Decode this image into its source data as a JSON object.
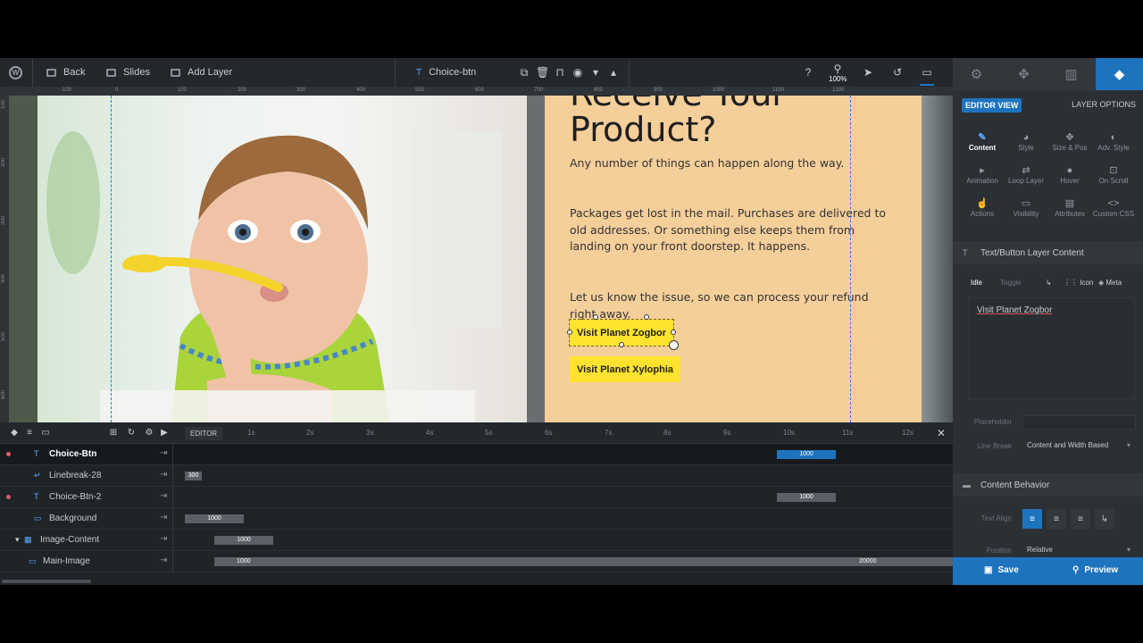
{
  "toolbar": {
    "back_label": "Back",
    "slides_label": "Slides",
    "add_layer_label": "Add Layer",
    "selected_layer": "Choice-btn",
    "zoom": "100%"
  },
  "ruler": {
    "top_ticks": [
      "-100",
      "0",
      "100",
      "200",
      "300",
      "400",
      "500",
      "600",
      "700",
      "800",
      "900",
      "1000",
      "1100",
      "1200"
    ],
    "left_ticks": [
      "100",
      "200",
      "300",
      "400",
      "500",
      "600",
      "700"
    ]
  },
  "slide": {
    "heading_line1": "Receive Your",
    "heading_line2": "Product?",
    "para1": "Any number of things can happen along the way.",
    "para2": "Packages get lost in the mail. Purchases are delivered to old addresses. Or something else keeps them from landing on your front doorstep. It happens.",
    "para3": "Let us know the issue, so we can process your refund right away.",
    "button1": "Visit Planet Zogbor",
    "button2": "Visit Planet Xylophia"
  },
  "timeline": {
    "editor_tag": "EDITOR",
    "seconds": [
      "1s",
      "2s",
      "3s",
      "4s",
      "5s",
      "6s",
      "7s",
      "8s",
      "9s",
      "10s",
      "11s",
      "12s"
    ],
    "rows": [
      {
        "name": "Choice-Btn",
        "bar_start": "1000",
        "bar_end": ""
      },
      {
        "name": "Linebreak-28",
        "bar_start": "300",
        "bar_end": ""
      },
      {
        "name": "Choice-Btn-2",
        "bar_start": "1000",
        "bar_end": ""
      },
      {
        "name": "Background",
        "bar_start": "1000",
        "bar_end": ""
      },
      {
        "name": "Image-Content",
        "bar_start": "1000",
        "bar_end": ""
      },
      {
        "name": "Main-Image",
        "bar_start": "1000",
        "bar_end": "20000"
      }
    ]
  },
  "panel": {
    "editor_view": "EDITOR VIEW",
    "layer_options": "LAYER OPTIONS",
    "tools": [
      "Content",
      "Style",
      "Size & Pos",
      "Adv. Style",
      "Animation",
      "Loop Layer",
      "Hover",
      "On Scroll",
      "Actions",
      "Visibility",
      "Attributes",
      "Custom CSS"
    ],
    "section1": "Text/Button Layer Content",
    "idle": "Idle",
    "toggle": "Toggle",
    "icon_label": "Icon",
    "meta_label": "Meta",
    "content_text": "Visit Planet Zogbor",
    "placeholder_label": "Placeholder",
    "line_break_label": "Line Break",
    "line_break_value": "Content and Width Based",
    "section2": "Content Behavior",
    "text_align_label": "Text Align",
    "position_label": "Position",
    "position_value": "Relative",
    "save": "Save",
    "preview": "Preview"
  },
  "colors": {
    "accent": "#1e73be",
    "button_yellow": "#ffe32e",
    "slide_bg": "#f5cf9a",
    "marker": "#e05a6a"
  }
}
